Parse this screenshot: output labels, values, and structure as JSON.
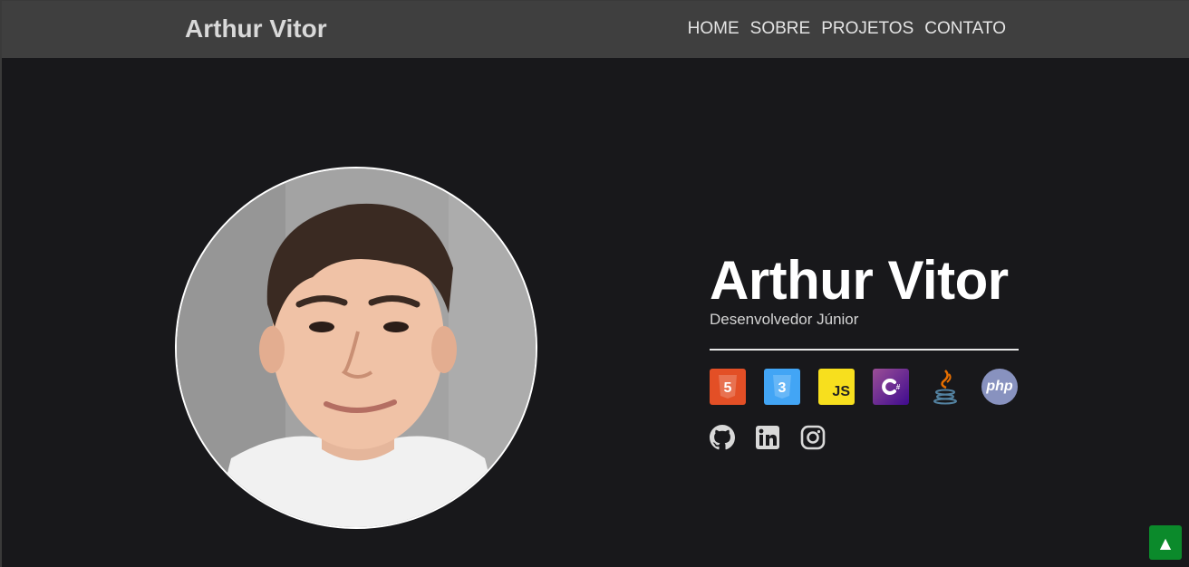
{
  "navbar": {
    "brand": "Arthur Vitor",
    "links": [
      "HOME",
      "SOBRE",
      "PROJETOS",
      "CONTATO"
    ]
  },
  "hero": {
    "name": "Arthur Vitor",
    "role": "Desenvolvedor Júnior"
  },
  "tech_icons": [
    {
      "name": "html5-icon",
      "label": "5",
      "color": "#e34f26"
    },
    {
      "name": "css3-icon",
      "label": "3",
      "color": "#42a5f5"
    },
    {
      "name": "javascript-icon",
      "label": "JS",
      "color": "#f7df1e"
    },
    {
      "name": "csharp-icon",
      "label": "C#",
      "color": "#68217a"
    },
    {
      "name": "java-icon",
      "label": "",
      "color": "#5382a1"
    },
    {
      "name": "php-icon",
      "label": "php",
      "color": "#8892bf"
    }
  ],
  "social_icons": [
    "github-icon",
    "linkedin-icon",
    "instagram-icon"
  ],
  "scroll_top": {
    "symbol": "▲",
    "color": "#0b8a2b"
  }
}
